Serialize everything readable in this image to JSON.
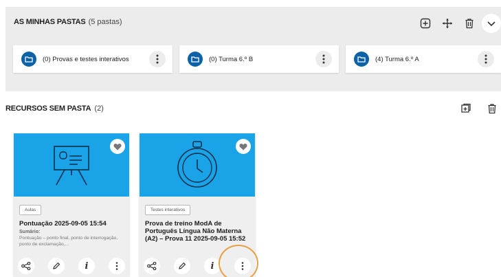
{
  "folders_section": {
    "title": "AS MINHAS PASTAS",
    "count": "(5 pastas)",
    "folders": [
      {
        "label": "(0) Provas e testes interativos"
      },
      {
        "label": "(0) Turma 6.º B"
      },
      {
        "label": "(4) Turma 6.º A"
      }
    ],
    "actions": [
      "add-folder-icon",
      "move-icon",
      "trash-icon",
      "chevron-down-icon"
    ]
  },
  "resources_section": {
    "title": "RECURSOS SEM PASTA",
    "count": "(2)",
    "actions": [
      "move-to-folder-icon",
      "trash-icon"
    ],
    "cards": [
      {
        "tag": "Aulas",
        "title": "Pontuação 2025-09-05 15:54",
        "summary_label": "Sumário:",
        "summary": "Pontuação – ponto final, ponto de interrogação, ponto de exclamação,..."
      },
      {
        "tag": "Testes interativos",
        "title": "Prova de treino ModA de Português Língua Não Materna (A2) – Prova 11 2025-09-05 15:52"
      }
    ]
  },
  "colors": {
    "brand_blue": "#1aa3e6",
    "folder_blue": "#0b62a6",
    "highlight": "#e8a046"
  }
}
